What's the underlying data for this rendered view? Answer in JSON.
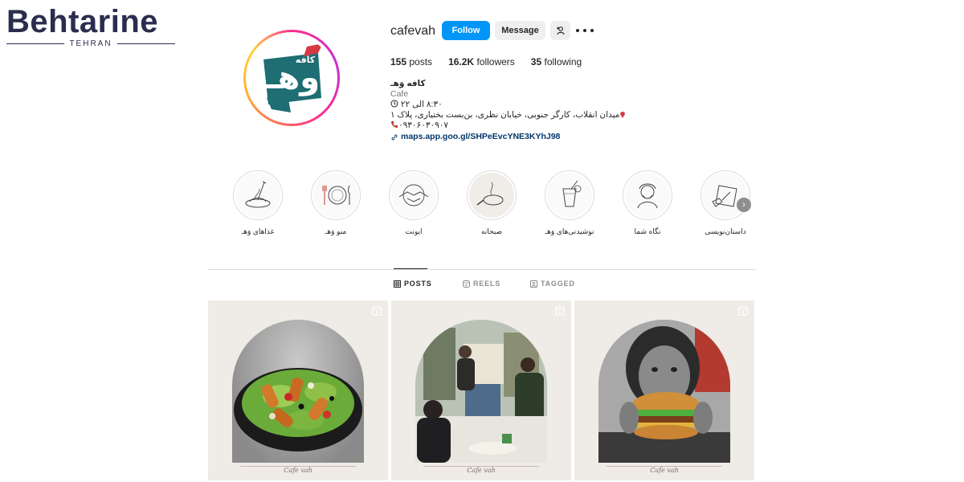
{
  "watermark": {
    "title": "Behtarine",
    "subtitle": "TEHRAN"
  },
  "profile": {
    "username": "cafevah",
    "follow_label": "Follow",
    "message_label": "Message",
    "stats": {
      "posts_count": "155",
      "posts_label": "posts",
      "followers_count": "16.2K",
      "followers_label": "followers",
      "following_count": "35",
      "following_label": "following"
    },
    "bio": {
      "name": "کافه وَهـ",
      "category": "Cafe",
      "hours": "۸:۳۰ الی ۲۲",
      "address": "میدان انقلاب، کارگر جنوبی، خیابان نظری، بن‌بست بختیاری، پلاک ۱",
      "phone": "۰۹۳۰۶۰۳۰۹۰۷",
      "link": "maps.app.goo.gl/SHPeEvcYNE3KYhJ98"
    },
    "avatar_text": "کافه وهـ"
  },
  "highlights": [
    {
      "label": "غذاهای وَهـ",
      "icon": "spaghetti-fork-icon"
    },
    {
      "label": "منو وَهـ",
      "icon": "plate-cutlery-icon"
    },
    {
      "label": "ایونت",
      "icon": "handshake-icon"
    },
    {
      "label": "صبحانه",
      "icon": "frying-pan-icon"
    },
    {
      "label": "نوشیدنی‌های وَهـ",
      "icon": "drink-glass-icon"
    },
    {
      "label": "نگاه شما",
      "icon": "person-face-icon"
    },
    {
      "label": "داستان‌نویسی",
      "icon": "writing-hand-icon"
    }
  ],
  "tabs": [
    {
      "label": "POSTS",
      "active": true
    },
    {
      "label": "REELS",
      "active": false
    },
    {
      "label": "TAGGED",
      "active": false
    }
  ],
  "posts": [
    {
      "caption": "Cafe vah",
      "subject": "salad-bowl"
    },
    {
      "caption": "Cafe vah",
      "subject": "cafe-interior"
    },
    {
      "caption": "Cafe vah",
      "subject": "burger-woman"
    }
  ],
  "colors": {
    "follow": "#0095f6",
    "link": "#00376b",
    "accent_red": "#d63a45",
    "teal": "#1e6e73",
    "navy": "#2b2d4f"
  }
}
